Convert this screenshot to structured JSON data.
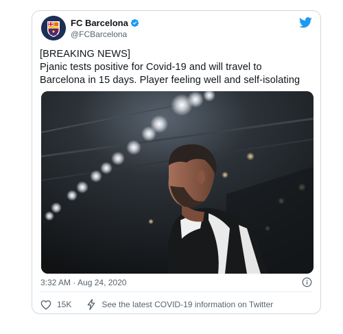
{
  "tweet": {
    "author": {
      "display_name": "FC Barcelona",
      "handle": "@FCBarcelona",
      "verified": true,
      "avatar_icon": "fc-barcelona-crest-icon"
    },
    "text": "[BREAKING NEWS]\nPjanic tests positive for Covid-19 and will travel to\nBarcelona in 15 days. Player feeling well and self-isolating",
    "media": {
      "kind": "photo"
    },
    "timestamp": "3:32 AM · Aug 24, 2020",
    "likes": "15K",
    "covid_info_label": "See the latest COVID-19 information on Twitter"
  },
  "icons": {
    "brand": "twitter-bird-icon",
    "verified": "verified-badge-icon",
    "info": "info-icon",
    "like": "heart-icon",
    "covid": "lightning-icon"
  },
  "colors": {
    "twitter_blue": "#1d9bf0",
    "text_primary": "#0f1419",
    "text_secondary": "#536471",
    "border": "#cfd9de"
  }
}
